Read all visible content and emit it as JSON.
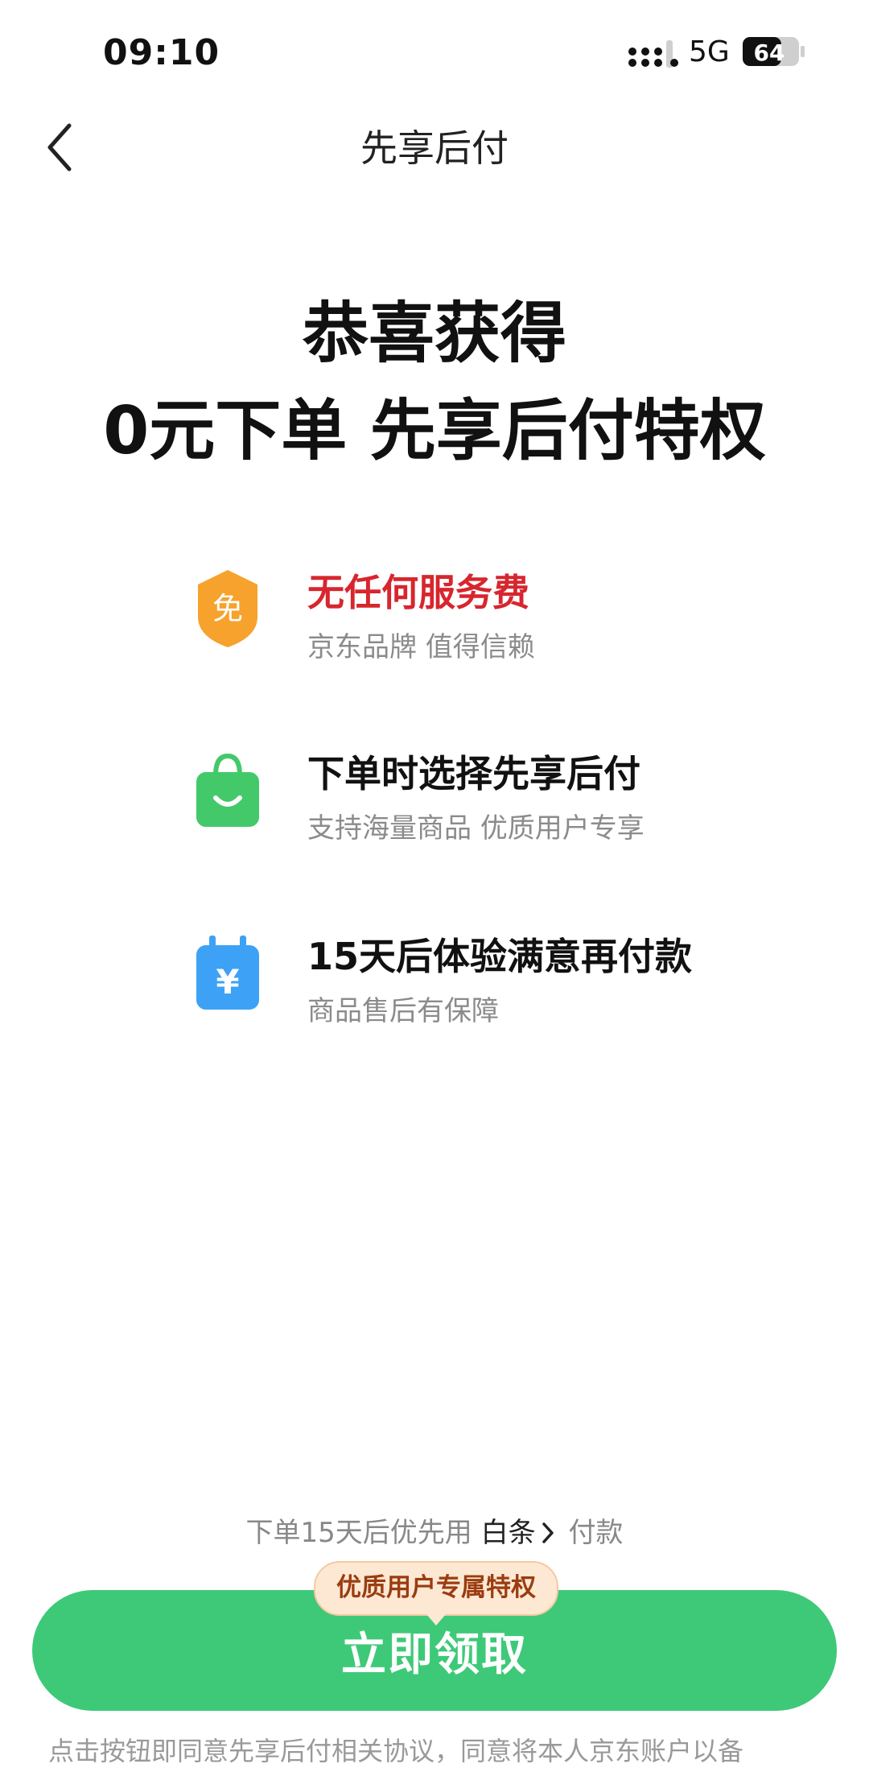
{
  "status": {
    "time": "09:10",
    "network": "5G",
    "battery": "64"
  },
  "nav": {
    "title": "先享后付"
  },
  "headline": {
    "line1": "恭喜获得",
    "line2": "0元下单 先享后付特权"
  },
  "features": [
    {
      "icon": "free-shield-icon",
      "icon_text": "免",
      "title": "无任何服务费",
      "subtitle": "京东品牌 值得信赖",
      "color": "#f6a22c"
    },
    {
      "icon": "shopping-bag-icon",
      "title": "下单时选择先享后付",
      "subtitle": "支持海量商品 优质用户专享",
      "color": "#43c96a"
    },
    {
      "icon": "calendar-yen-icon",
      "icon_text": "¥",
      "title": "15天后体验满意再付款",
      "subtitle": "商品售后有保障",
      "color": "#3da2f5"
    }
  ],
  "payment": {
    "prefix": "下单15天后优先用",
    "method": "白条",
    "suffix": "付款"
  },
  "cta": {
    "badge": "优质用户专属特权",
    "label": "立即领取",
    "color": "#3ec979"
  },
  "footer": {
    "note": "点击按钮即同意先享后付相关协议，同意将本人京东账户以备"
  }
}
